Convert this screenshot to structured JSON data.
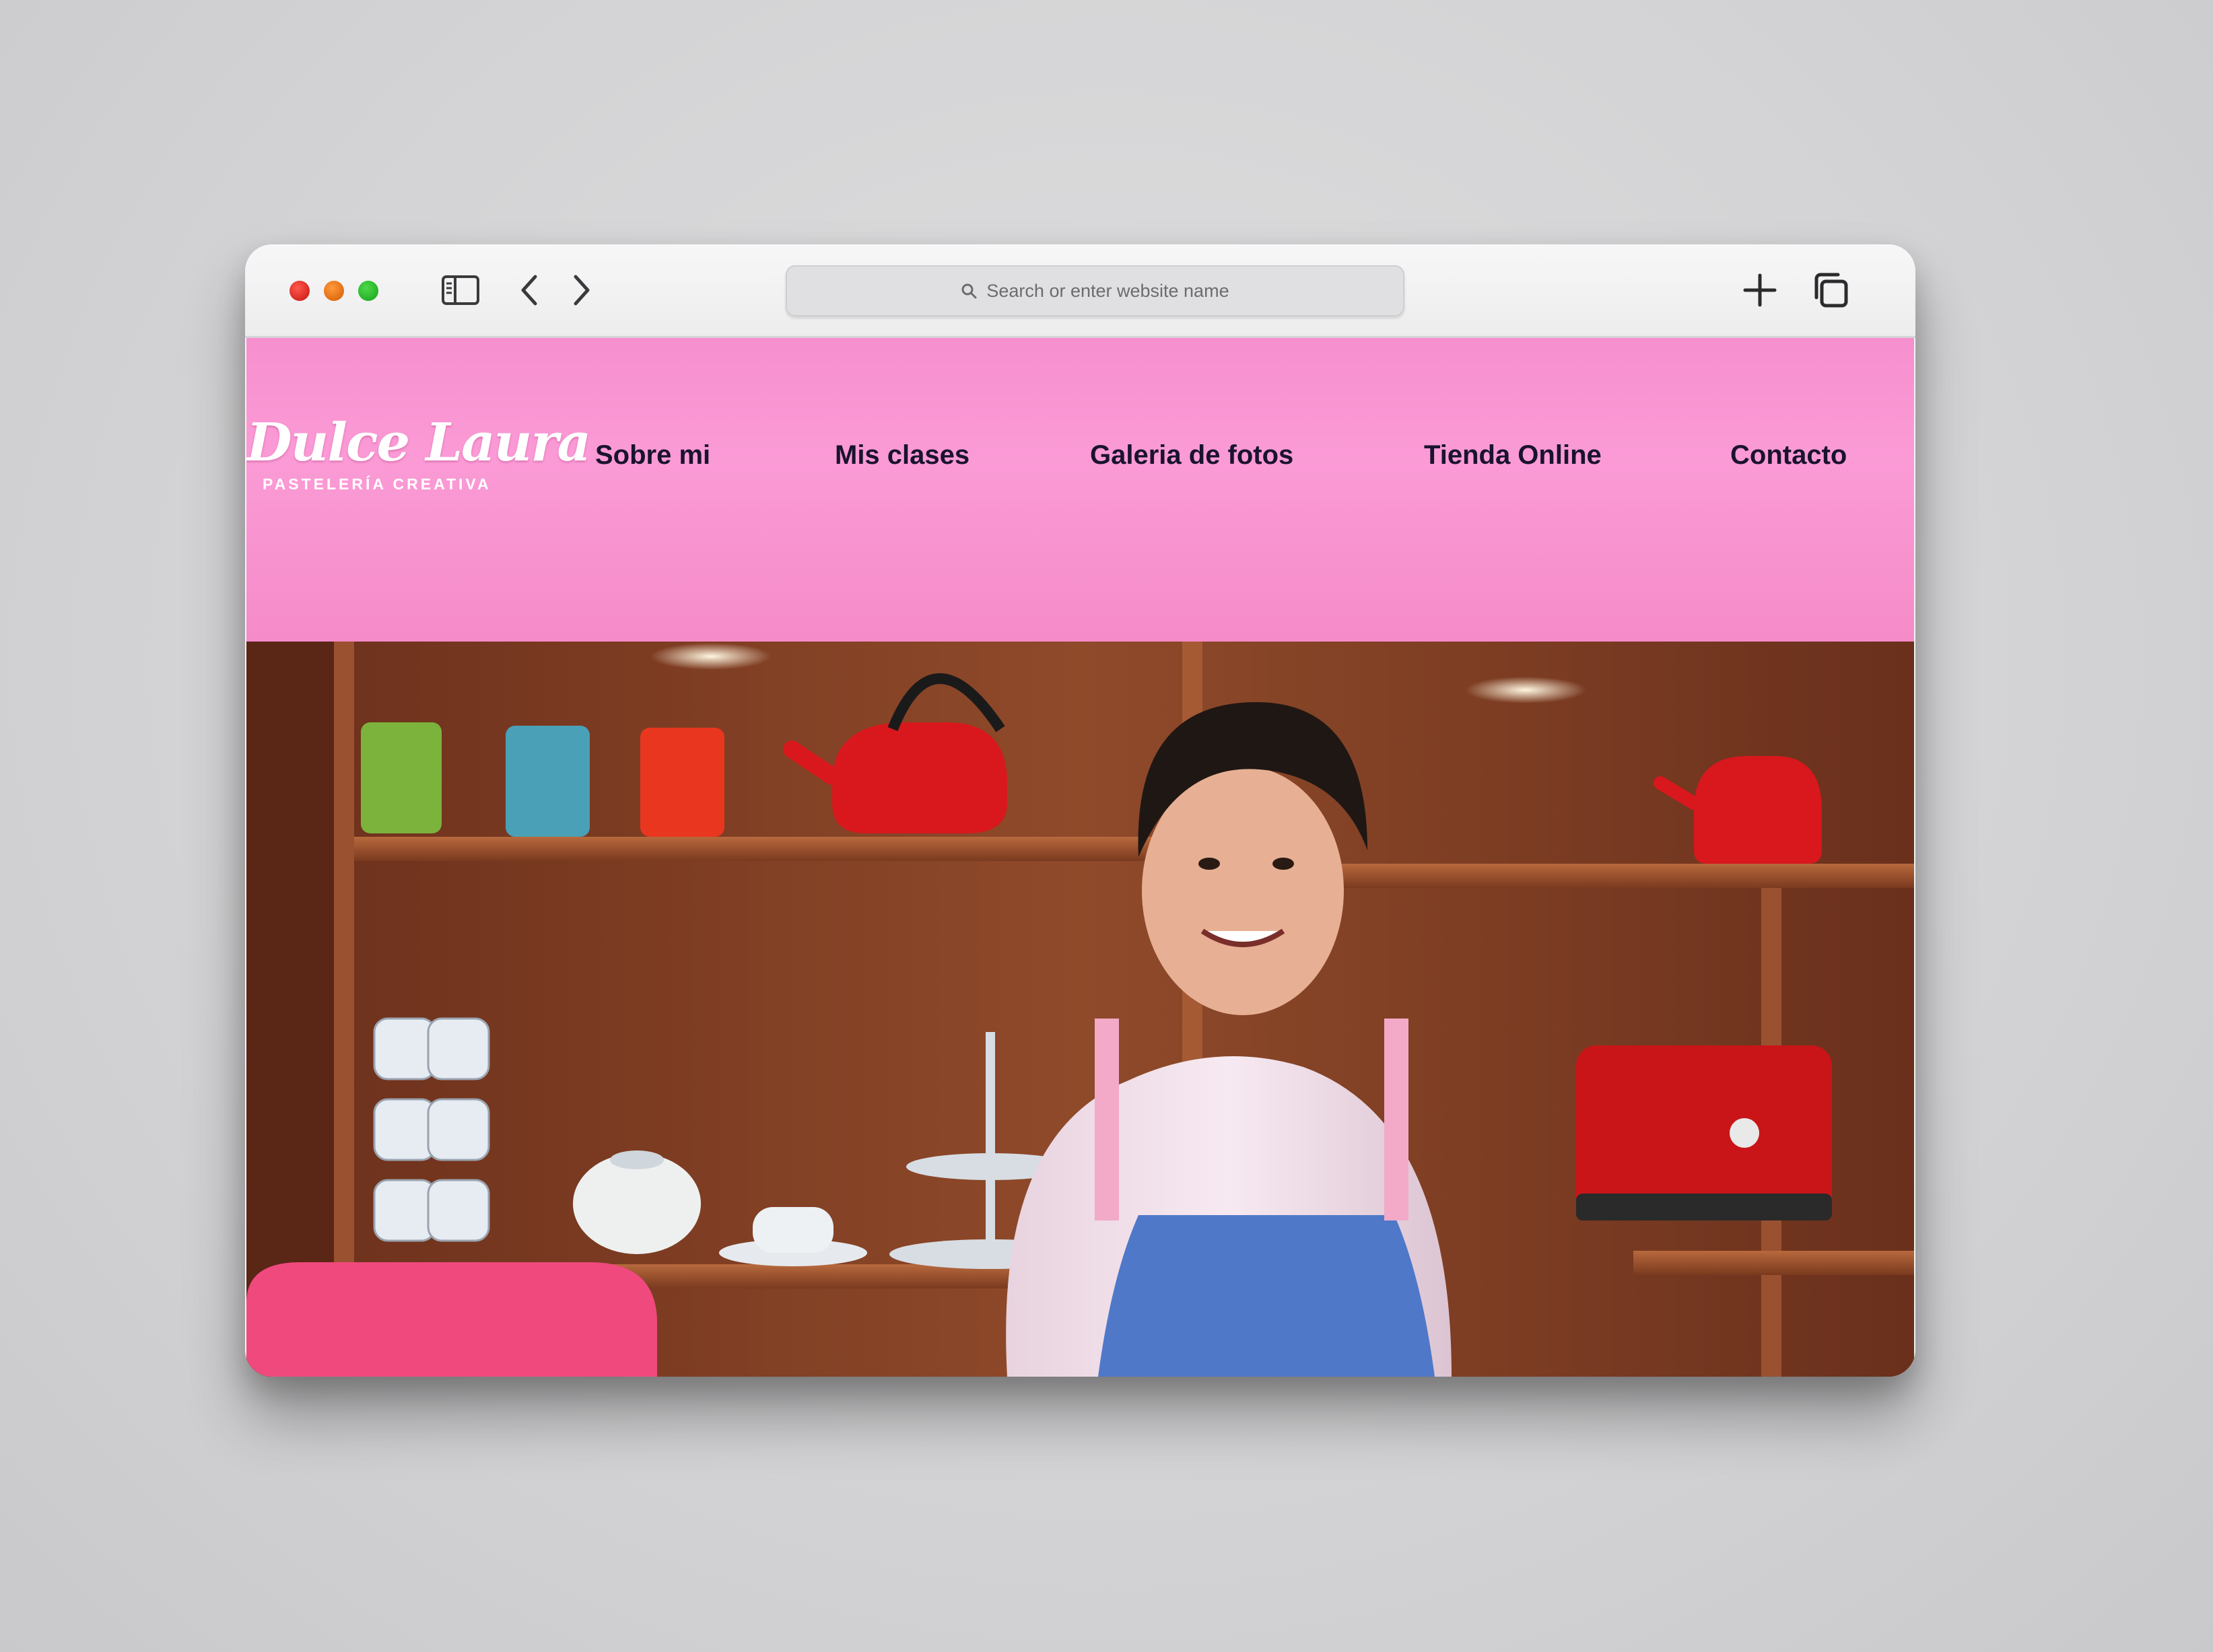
{
  "browser": {
    "address_placeholder": "Search or enter website name"
  },
  "site": {
    "logo_script": "Dulce Laura",
    "logo_sub": "PASTELERÍA CREATIVA",
    "nav": [
      "Sobre mi",
      "Mis clases",
      "Galeria de fotos",
      "Tienda Online",
      "Contacto"
    ]
  },
  "colors": {
    "header_pink": "#fb9bd6",
    "nav_text": "#1a1330"
  }
}
